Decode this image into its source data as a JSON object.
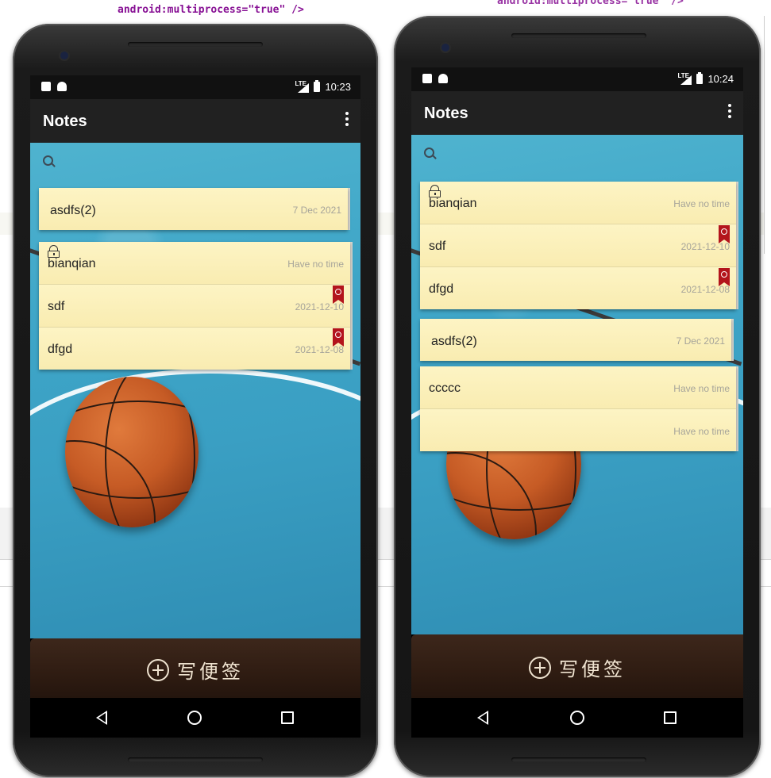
{
  "ide": {
    "top_code_left": "android:multiprocess=\"true\" />",
    "top_code_right": "android:multiprocess=\"true\" />"
  },
  "phones": [
    {
      "status": {
        "time": "10:23",
        "network": "LTE"
      },
      "appbar": {
        "title": "Notes"
      },
      "search": {
        "icon": "search-icon"
      },
      "single_note": {
        "title": "asdfs(2)",
        "time": "7 Dec 2021"
      },
      "group_notes": [
        {
          "title": "bianqian",
          "time": "Have no time",
          "locked": true,
          "alarm": false
        },
        {
          "title": "sdf",
          "time": "2021-12-10",
          "locked": false,
          "alarm": true
        },
        {
          "title": "dfgd",
          "time": "2021-12-08",
          "locked": false,
          "alarm": true
        }
      ],
      "footer": {
        "new_note_label": "写便签"
      }
    },
    {
      "status": {
        "time": "10:24",
        "network": "LTE"
      },
      "appbar": {
        "title": "Notes"
      },
      "search": {
        "icon": "search-icon"
      },
      "group_notes": [
        {
          "title": "bianqian",
          "time": "Have no time",
          "locked": true,
          "alarm": false
        },
        {
          "title": "sdf",
          "time": "2021-12-10",
          "locked": false,
          "alarm": true
        },
        {
          "title": "dfgd",
          "time": "2021-12-08",
          "locked": false,
          "alarm": true
        }
      ],
      "single_note": {
        "title": "asdfs(2)",
        "time": "7 Dec 2021"
      },
      "group_notes_2": [
        {
          "title": "ccccc",
          "time": "Have no time"
        },
        {
          "title": "",
          "time": "Have no time"
        }
      ],
      "footer": {
        "new_note_label": "写便签"
      }
    }
  ],
  "colors": {
    "note_bg": "#fbf0b8",
    "appbar": "#212121",
    "alarm": "#b3141c",
    "footer": "#2f1c12"
  }
}
